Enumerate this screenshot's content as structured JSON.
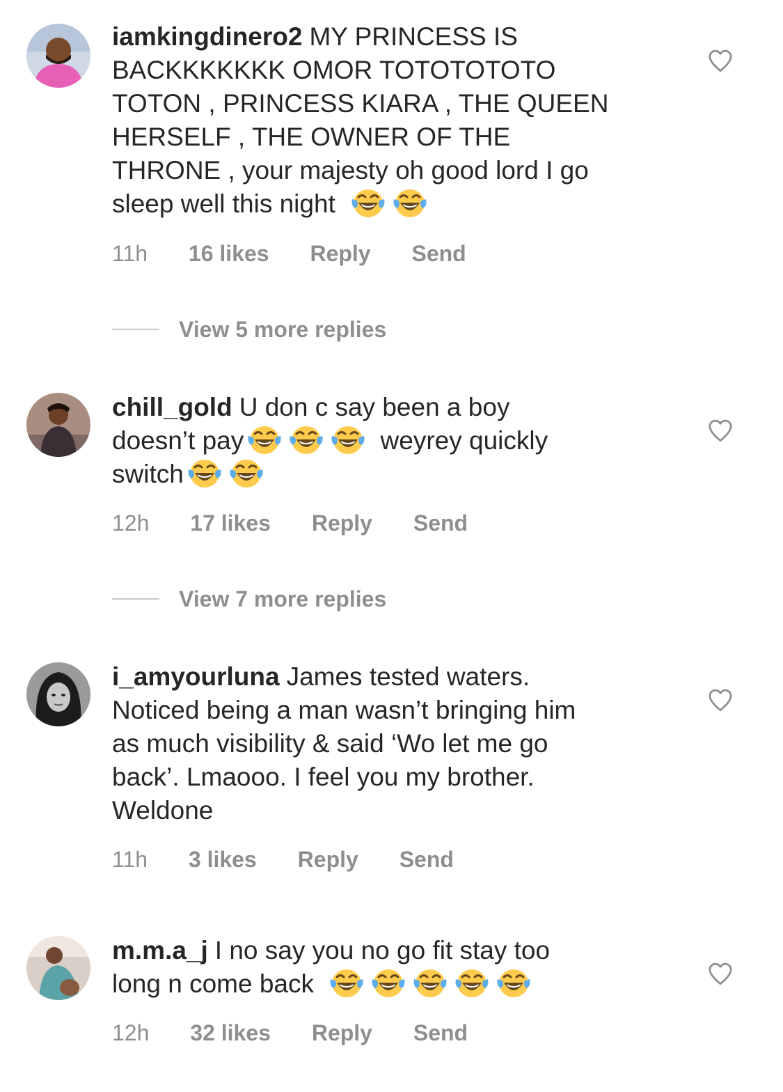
{
  "comments": [
    {
      "username": "iamkingdinero2",
      "lines": [
        {
          "text": "MY PRINCESS IS"
        },
        {
          "text": "BACKKKKKKK OMOR TOTOTOTOTO"
        },
        {
          "text": "TOTON , PRINCESS KIARA , THE QUEEN"
        },
        {
          "text": "HERSELF , THE OWNER OF THE"
        },
        {
          "text": "THRONE , your majesty oh good lord I go"
        },
        {
          "text": "sleep well this night"
        }
      ],
      "time": "11h",
      "likes": "16 likes",
      "reply": "Reply",
      "send": "Send",
      "view_more": "View 5 more replies"
    },
    {
      "username": "chill_gold",
      "lines": [
        {
          "text": "U don c say been a boy"
        },
        {
          "text": "doesn’t pay"
        },
        {
          "text": "weyrey quickly"
        },
        {
          "text": "switch"
        }
      ],
      "time": "12h",
      "likes": "17 likes",
      "reply": "Reply",
      "send": "Send",
      "view_more": "View 7 more replies"
    },
    {
      "username": "i_amyourluna",
      "lines": [
        {
          "text": "James tested waters."
        },
        {
          "text": "Noticed being a man wasn’t bringing him"
        },
        {
          "text": "as much visibility & said ‘Wo let me go"
        },
        {
          "text": "back’. Lmaooo. I feel you my brother."
        },
        {
          "text": "Weldone"
        }
      ],
      "time": "11h",
      "likes": "3 likes",
      "reply": "Reply",
      "send": "Send"
    },
    {
      "username": "m.m.a_j",
      "lines": [
        {
          "text": "I no say you no go fit stay too"
        },
        {
          "text": "long n come back"
        }
      ],
      "time": "12h",
      "likes": "32 likes",
      "reply": "Reply",
      "send": "Send"
    }
  ],
  "icons": {
    "like": "heart-outline-icon",
    "emoji": "face-with-tears-of-joy-emoji"
  },
  "colors": {
    "text": "#262626",
    "secondary": "#8e8e8e",
    "divider": "#c7c7c7",
    "emoji_face": "#ffcb4c",
    "emoji_tear": "#5dadec"
  }
}
